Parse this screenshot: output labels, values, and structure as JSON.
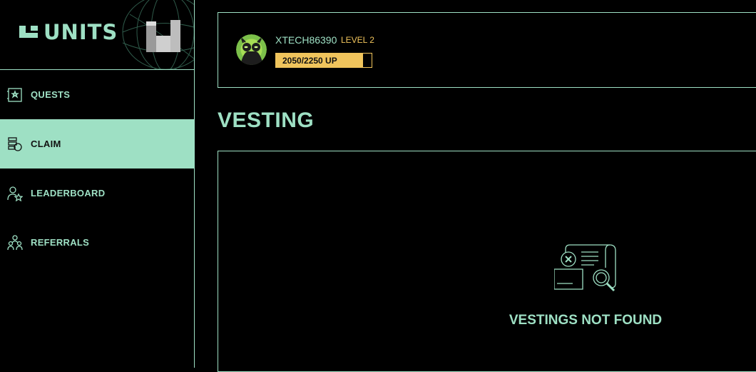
{
  "brand": {
    "logo_text": "UNITS",
    "accent_color": "#9ee0c4",
    "gold_color": "#f0c45c"
  },
  "sidebar": {
    "items": [
      {
        "label": "QUESTS",
        "icon": "quest-icon",
        "active": false
      },
      {
        "label": "CLAIM",
        "icon": "claim-icon",
        "active": true
      },
      {
        "label": "LEADERBOARD",
        "icon": "leaderboard-icon",
        "active": false
      },
      {
        "label": "REFERRALS",
        "icon": "referrals-icon",
        "active": false
      }
    ]
  },
  "profile": {
    "username": "XTECH86390",
    "level": "LEVEL 2",
    "xp_text": "2050/2250 UP",
    "xp_current": 2050,
    "xp_max": 2250
  },
  "main": {
    "title": "VESTING",
    "empty_message": "VESTINGS NOT FOUND",
    "empty_icon": "document-search-icon"
  }
}
